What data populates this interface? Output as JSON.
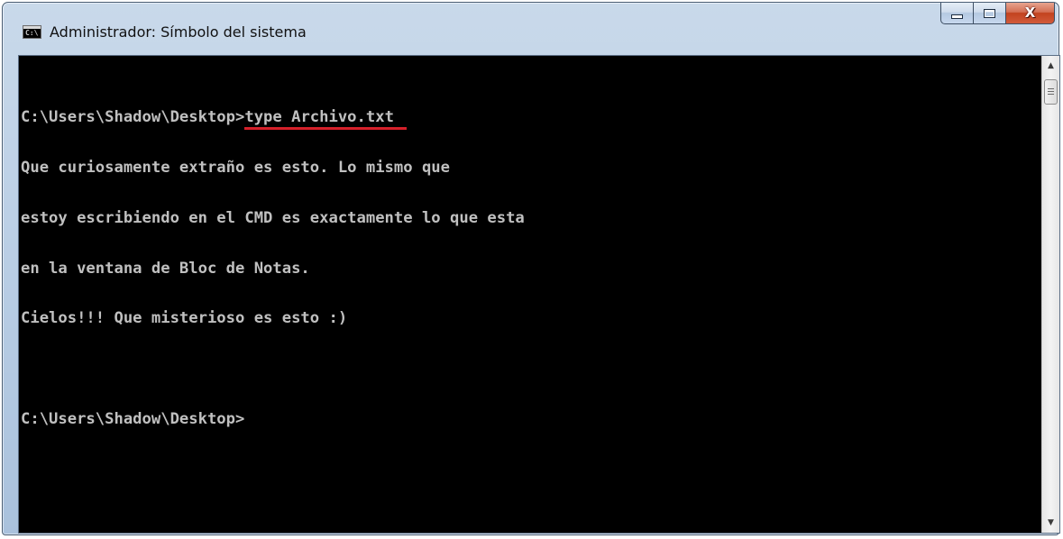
{
  "window": {
    "title": "Administrador: Símbolo del sistema",
    "icon": "cmd-icon",
    "icon_text": "C:\\",
    "controls": {
      "minimize_icon": "minimize-icon",
      "maximize_icon": "maximize-icon",
      "close_icon": "close-icon",
      "close_glyph": "X"
    }
  },
  "console": {
    "prompt": "C:\\Users\\Shadow\\Desktop>",
    "command": "type Archivo.txt",
    "output": [
      "Que curiosamente extraño es esto. Lo mismo que",
      "estoy escribiendo en el CMD es exactamente lo que esta",
      "en la ventana de Bloc de Notas.",
      "Cielos!!! Que misterioso es esto :)"
    ],
    "final_prompt": "C:\\Users\\Shadow\\Desktop>",
    "text_color": "#c0c0c0",
    "background_color": "#000000",
    "highlight_color": "#d6202a"
  },
  "scrollbar": {
    "up_arrow": "▲",
    "down_arrow": "▼"
  }
}
